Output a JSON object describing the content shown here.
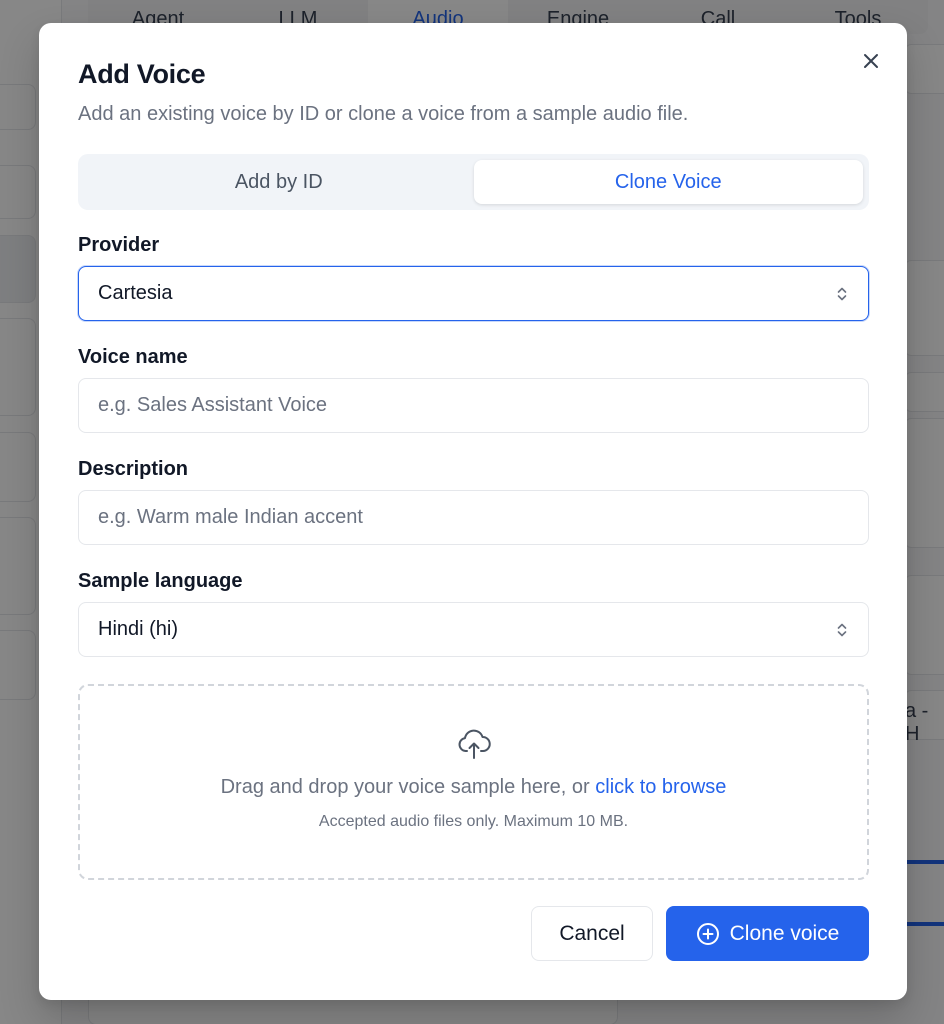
{
  "background": {
    "tabs": [
      "Agent",
      "LLM",
      "Audio",
      "Engine",
      "Call",
      "Tools"
    ],
    "active_tab": "Audio",
    "right_snippet": "a - H"
  },
  "modal": {
    "title": "Add Voice",
    "subtitle": "Add an existing voice by ID or clone a voice from a sample audio file.",
    "close_icon": "close-icon",
    "mode_tabs": [
      {
        "label": "Add by ID",
        "active": false
      },
      {
        "label": "Clone Voice",
        "active": true
      }
    ],
    "provider": {
      "label": "Provider",
      "value": "Cartesia"
    },
    "voice_name": {
      "label": "Voice name",
      "placeholder": "e.g. Sales Assistant Voice",
      "value": ""
    },
    "description": {
      "label": "Description",
      "placeholder": "e.g. Warm male Indian accent",
      "value": ""
    },
    "sample_language": {
      "label": "Sample language",
      "value": "Hindi (hi)"
    },
    "dropzone": {
      "icon": "cloud-upload-icon",
      "text": "Drag and drop your voice sample here, or",
      "link": "click to browse",
      "hint": "Accepted audio files only. Maximum 10 MB."
    },
    "buttons": {
      "cancel": "Cancel",
      "clone": "Clone voice",
      "clone_icon": "plus-circle-icon"
    }
  },
  "colors": {
    "accent": "#2563eb",
    "muted_text": "#6b7280",
    "border": "#e5e7eb",
    "segment_bg": "#f1f4f8"
  }
}
